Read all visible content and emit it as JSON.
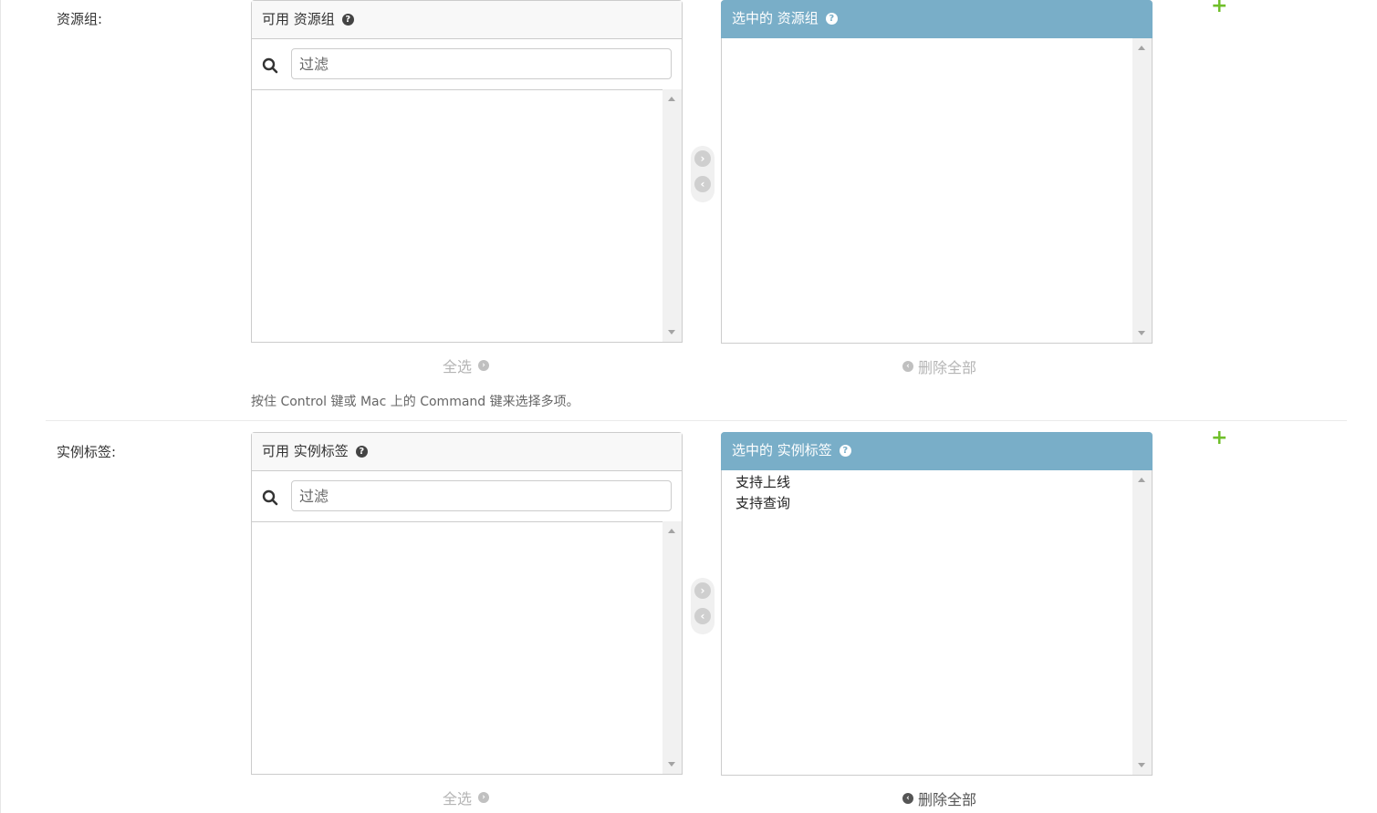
{
  "groups": [
    {
      "label": "资源组:",
      "available_title": "可用 资源组",
      "chosen_title": "选中的 资源组",
      "filter_placeholder": "过滤",
      "choose_all": "全选",
      "clear_all": "删除全部",
      "chosen_items": [],
      "help_text": "按住 Control 键或 Mac 上的 Command 键来选择多项。"
    },
    {
      "label": "实例标签:",
      "available_title": "可用 实例标签",
      "chosen_title": "选中的 实例标签",
      "filter_placeholder": "过滤",
      "choose_all": "全选",
      "clear_all": "删除全部",
      "chosen_items": [
        "支持上线",
        "支持查询"
      ]
    }
  ],
  "icons": {
    "help": "?",
    "add": "+",
    "move_right": "›",
    "move_left": "‹"
  },
  "colors": {
    "chosen_header": "#79aec8",
    "add_related": "#70bf2b"
  }
}
